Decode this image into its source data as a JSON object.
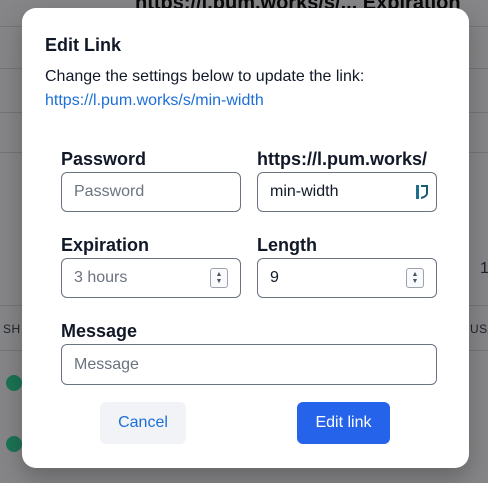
{
  "background": {
    "header_fragment": "https://l.pum.works/s/... Expiration",
    "col_short": "SH",
    "col_usage": "USA",
    "count_fragment": "1"
  },
  "modal": {
    "title": "Edit Link",
    "description": "Change the settings below to update the link:",
    "link_url": "https://l.pum.works/s/min-width",
    "password": {
      "label": "Password",
      "placeholder": "Password",
      "value": ""
    },
    "slug": {
      "label": "https://l.pum.works/",
      "value": "min-width",
      "icon": "bitwarden-icon"
    },
    "expiration": {
      "label": "Expiration",
      "value": "3 hours"
    },
    "length": {
      "label": "Length",
      "value": "9"
    },
    "message": {
      "label": "Message",
      "placeholder": "Message",
      "value": ""
    },
    "cancel_label": "Cancel",
    "submit_label": "Edit link",
    "colors": {
      "accent": "#2563eb",
      "link": "#1d6fd8",
      "cancel_bg": "#f1f3f6"
    }
  }
}
